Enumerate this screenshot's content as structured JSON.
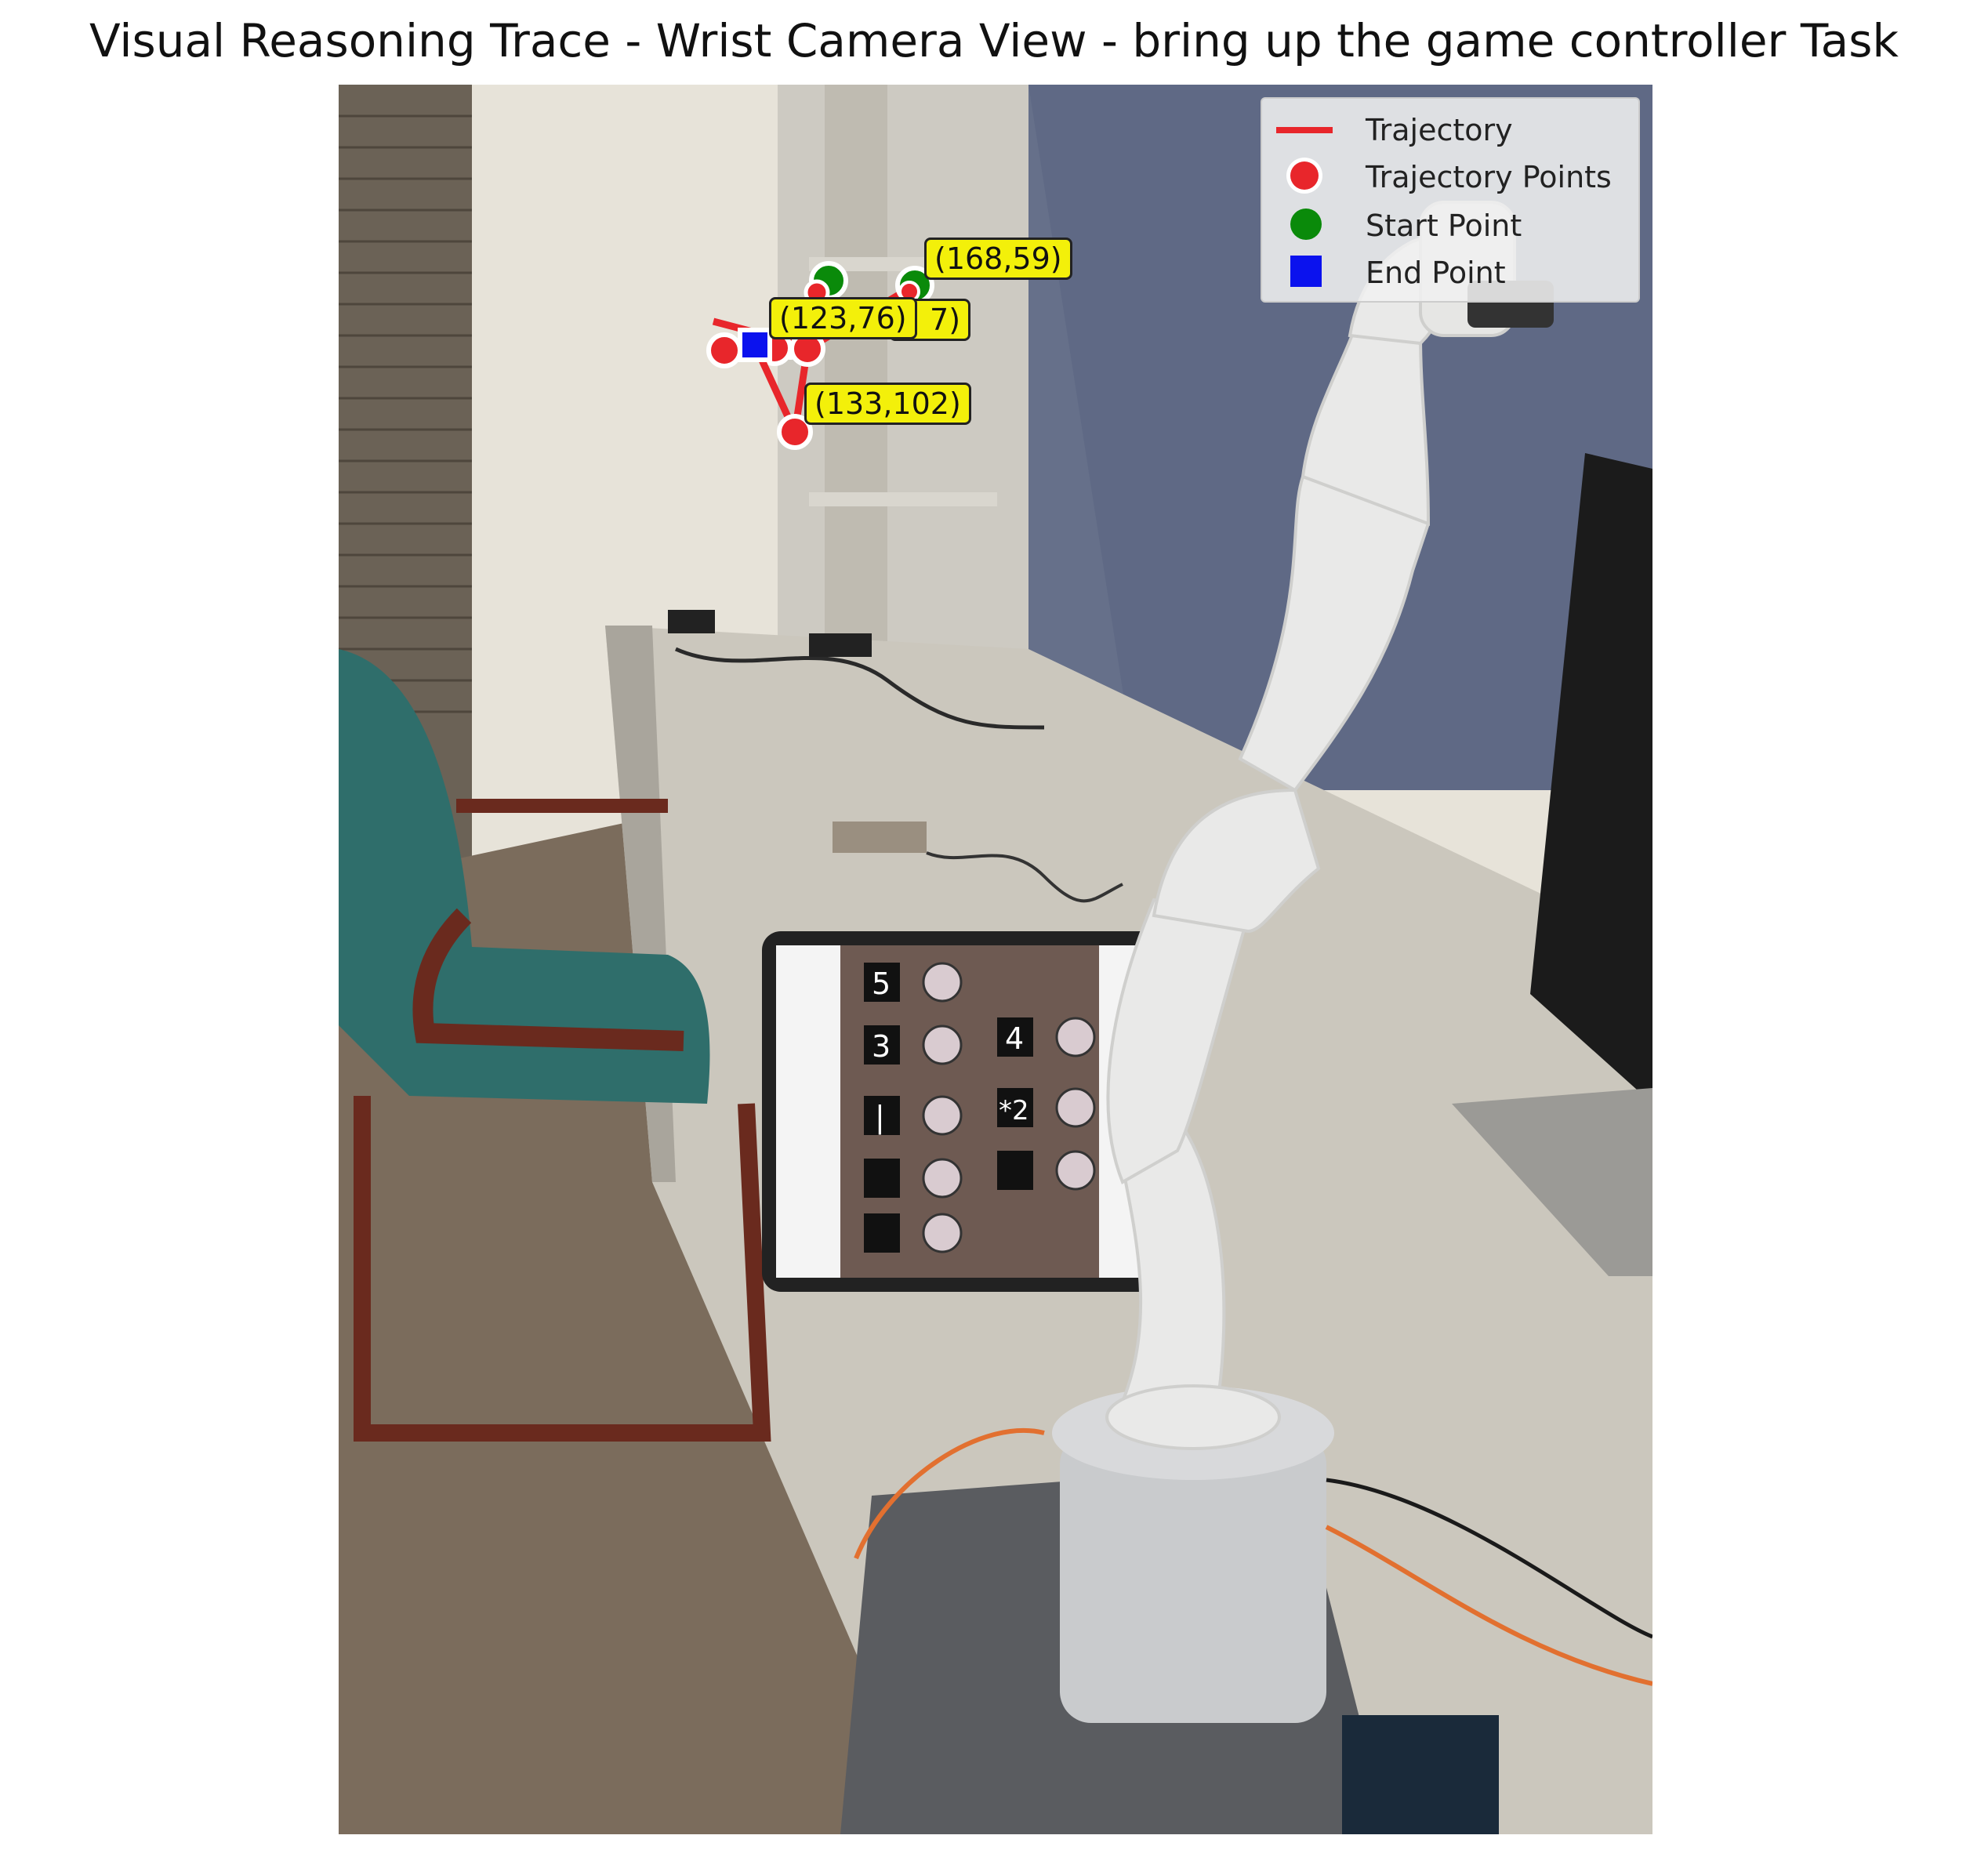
{
  "title": "Visual Reasoning Trace - Wrist Camera View - bring up the game controller Task",
  "legend": {
    "trajectory": "Trajectory",
    "trajectory_points": "Trajectory Points",
    "start_point": "Start Point",
    "end_point": "End Point"
  },
  "colors": {
    "trajectory": "#e8262b",
    "start": "#0a8a0a",
    "end": "#0b12ee",
    "label_bg": "#f3f00a"
  },
  "annotations": {
    "start": "(168,59)",
    "p2": "(123,76)",
    "p3_partial": "7)",
    "p4": "(133,102)"
  },
  "tablet": {
    "keys": [
      "5",
      "3",
      "4",
      "|",
      "*2"
    ]
  }
}
